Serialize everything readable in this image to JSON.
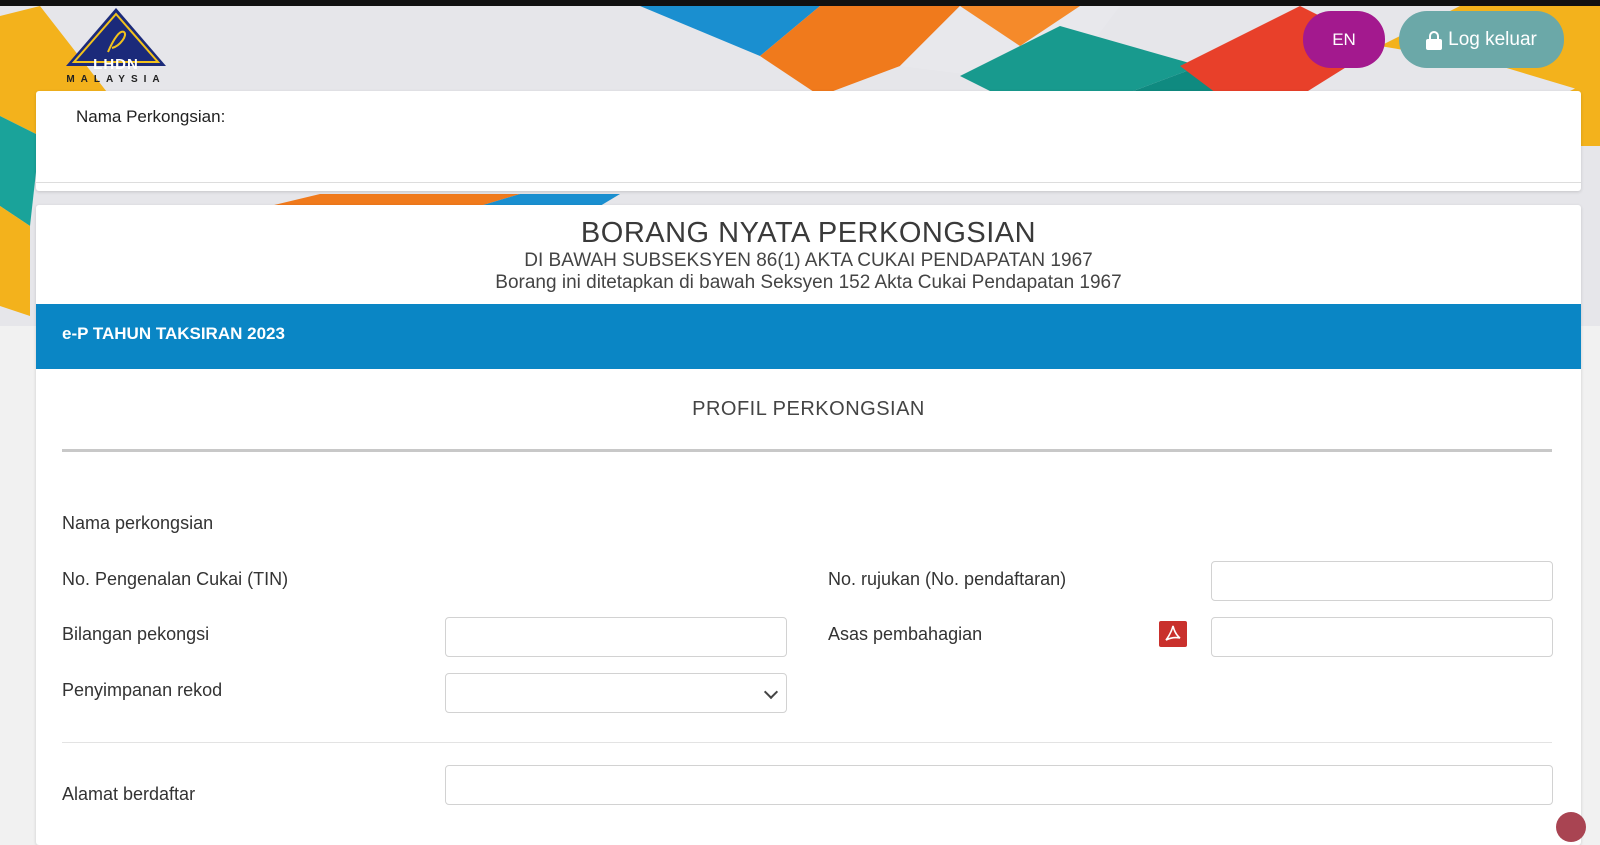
{
  "header": {
    "logo_text": "LHDN",
    "logo_country": "MALAYSIA",
    "lang_button": "EN",
    "logout_button": "Log keluar"
  },
  "top_card": {
    "partnership_name_label": "Nama Perkongsian:"
  },
  "form_header": {
    "title": "BORANG NYATA PERKONGSIAN",
    "subtitle_1": "DI BAWAH SUBSEKSYEN 86(1) AKTA CUKAI PENDAPATAN 1967",
    "subtitle_2": "Borang ini ditetapkan di bawah Seksyen 152 Akta Cukai Pendapatan 1967",
    "year_bar": "e-P TAHUN TAKSIRAN 2023"
  },
  "profile": {
    "section_title": "PROFIL PERKONGSIAN",
    "fields": {
      "nama_perkongsian": "Nama perkongsian",
      "tin": "No. Pengenalan Cukai (TIN)",
      "no_rujukan": "No. rujukan (No. pendaftaran)",
      "bilangan_pekongsi": "Bilangan pekongsi",
      "asas_pembahagian": "Asas pembahagian",
      "penyimpanan_rekod": "Penyimpanan rekod",
      "alamat_berdaftar": "Alamat berdaftar"
    },
    "values": {
      "no_rujukan": "",
      "bilangan_pekongsi": "",
      "asas_pembahagian": "",
      "penyimpanan_rekod": "",
      "alamat_berdaftar": ""
    }
  },
  "icons": {
    "pdf": "pdf-icon",
    "lock": "lock-icon",
    "chevron": "chevron-down-icon"
  },
  "colors": {
    "year_bar": "#0a86c5",
    "lang_button": "#a3198e",
    "logout_button": "#6ba8a8",
    "pdf_icon": "#c9302c"
  }
}
